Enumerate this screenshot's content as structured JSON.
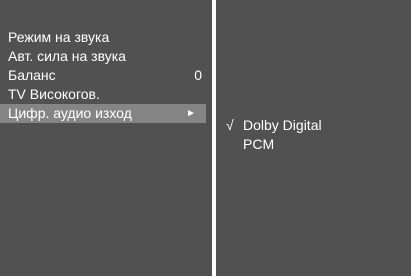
{
  "menu": {
    "items": [
      {
        "label": "Режим на звука",
        "value": ""
      },
      {
        "label": "Авт. сила на звука",
        "value": ""
      },
      {
        "label": "Баланс",
        "value": "0"
      },
      {
        "label": "TV Високогов.",
        "value": ""
      },
      {
        "label": "Цифр. аудио изход",
        "value": "",
        "arrow": "►"
      }
    ],
    "selected_index": 4
  },
  "submenu": {
    "items": [
      {
        "label": "Dolby Digital",
        "mark": "√"
      },
      {
        "label": "PCM",
        "mark": ""
      }
    ]
  },
  "colors": {
    "panel": "#515151",
    "highlight": "#858585",
    "divider": "#ffffff",
    "text": "#ffffff"
  }
}
